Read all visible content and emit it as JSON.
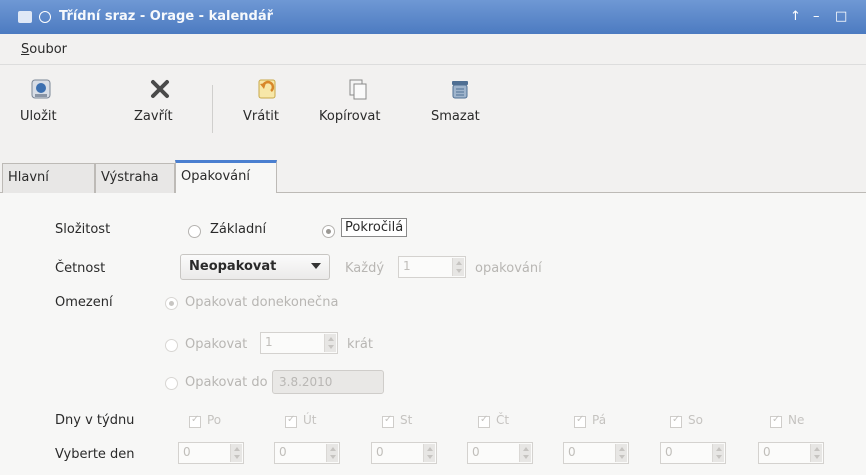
{
  "window": {
    "title": "Třídní sraz - Orage - kalendář",
    "controls": [
      "↑",
      "–",
      "□"
    ]
  },
  "menu": {
    "file_mnemonic": "S",
    "file_rest": "oubor"
  },
  "toolbar": {
    "save": "Uložit",
    "close": "Zavřít",
    "revert": "Vrátit",
    "copy": "Kopírovat",
    "delete": "Smazat"
  },
  "tabs": {
    "main": "Hlavní",
    "alarm": "Výstraha",
    "recurrence": "Opakování"
  },
  "recurrence": {
    "complexity_label": "Složitost",
    "complexity_basic": "Základní",
    "complexity_advanced": "Pokročilá",
    "complexity_selected": "advanced",
    "frequency_label": "Četnost",
    "frequency_value": "Neopakovat",
    "every_label": "Každý",
    "every_value": "1",
    "every_unit": "opakování",
    "limit_label": "Omezení",
    "limit_forever": "Opakovat donekonečna",
    "limit_count_label": "Opakovat",
    "limit_count_value": "1",
    "limit_count_unit": "krát",
    "limit_until_label": "Opakovat do",
    "limit_until_date": "3.8.2010",
    "weekdays_label": "Dny v týdnu",
    "weekdays": [
      "Po",
      "Út",
      "St",
      "Čt",
      "Pá",
      "So",
      "Ne"
    ],
    "pick_day_label": "Vyberte den",
    "pick_day_values": [
      "0",
      "0",
      "0",
      "0",
      "0",
      "0",
      "0"
    ]
  },
  "colors": {
    "title_bar": "#5b88cb",
    "tab_accent": "#4a7fd0",
    "disabled_text": "#b8b6b3"
  },
  "icons": {
    "save": "save-icon",
    "close": "close-icon",
    "revert": "revert-icon",
    "copy": "copy-icon",
    "delete": "delete-icon"
  }
}
